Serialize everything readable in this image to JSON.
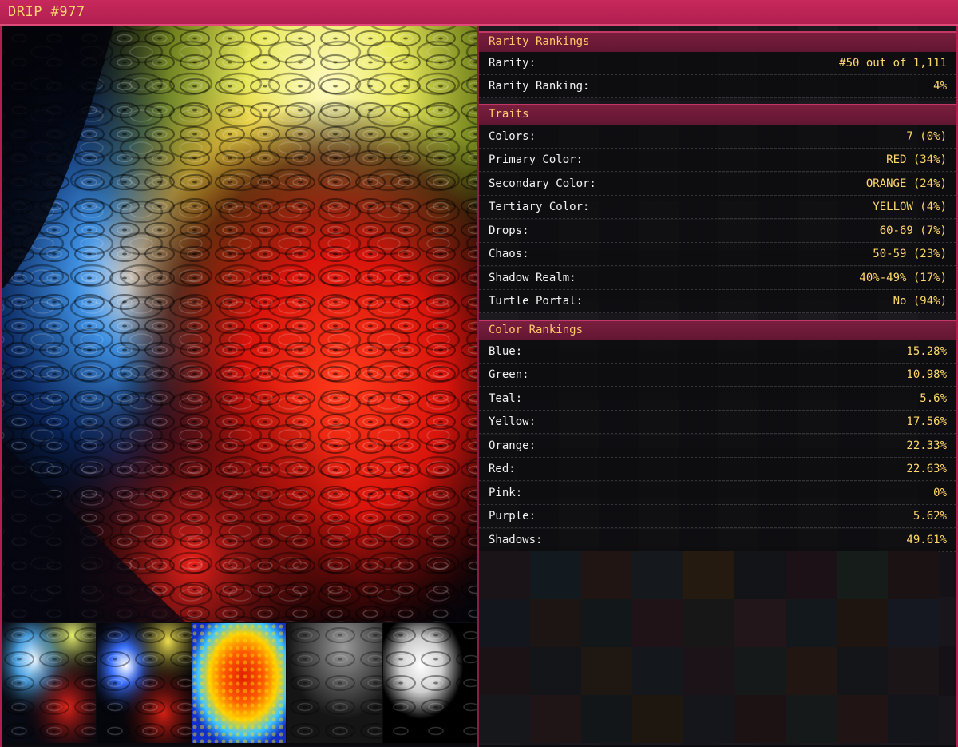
{
  "app": {
    "title": "DRIP #977"
  },
  "sections": {
    "rarity": {
      "heading": "Rarity Rankings",
      "rows": [
        {
          "label": "Rarity:",
          "value": "#50 out of 1,111"
        },
        {
          "label": "Rarity Ranking:",
          "value": "4%"
        }
      ]
    },
    "traits": {
      "heading": "Traits",
      "rows": [
        {
          "label": "Colors:",
          "value": "7 (0%)"
        },
        {
          "label": "Primary Color:",
          "value": "RED (34%)"
        },
        {
          "label": "Secondary Color:",
          "value": "ORANGE (24%)"
        },
        {
          "label": "Tertiary Color:",
          "value": "YELLOW (4%)"
        },
        {
          "label": "Drops:",
          "value": "60-69 (7%)"
        },
        {
          "label": "Chaos:",
          "value": "50-59 (23%)"
        },
        {
          "label": "Shadow Realm:",
          "value": "40%-49% (17%)"
        },
        {
          "label": "Turtle Portal:",
          "value": "No (94%)"
        }
      ]
    },
    "colors": {
      "heading": "Color Rankings",
      "rows": [
        {
          "label": "Blue:",
          "value": "15.28%"
        },
        {
          "label": "Green:",
          "value": "10.98%"
        },
        {
          "label": "Teal:",
          "value": "5.6%"
        },
        {
          "label": "Yellow:",
          "value": "17.56%"
        },
        {
          "label": "Orange:",
          "value": "22.33%"
        },
        {
          "label": "Red:",
          "value": "22.63%"
        },
        {
          "label": "Pink:",
          "value": "0%"
        },
        {
          "label": "Purple:",
          "value": "5.62%"
        },
        {
          "label": "Shadows:",
          "value": "49.61%"
        }
      ]
    }
  },
  "theme": {
    "titlebar": "#c8285c",
    "header_text": "#ffc86b",
    "value_text": "#ffd86b",
    "label_text": "#f2f2f2"
  },
  "thumbnails": [
    {
      "name": "thumb-original",
      "kind": "color-rain"
    },
    {
      "name": "thumb-saturated",
      "kind": "contrast-rain"
    },
    {
      "name": "thumb-heatmap",
      "kind": "heatmap"
    },
    {
      "name": "thumb-grayscale",
      "kind": "grayscale"
    },
    {
      "name": "thumb-threshold",
      "kind": "black-white"
    }
  ]
}
